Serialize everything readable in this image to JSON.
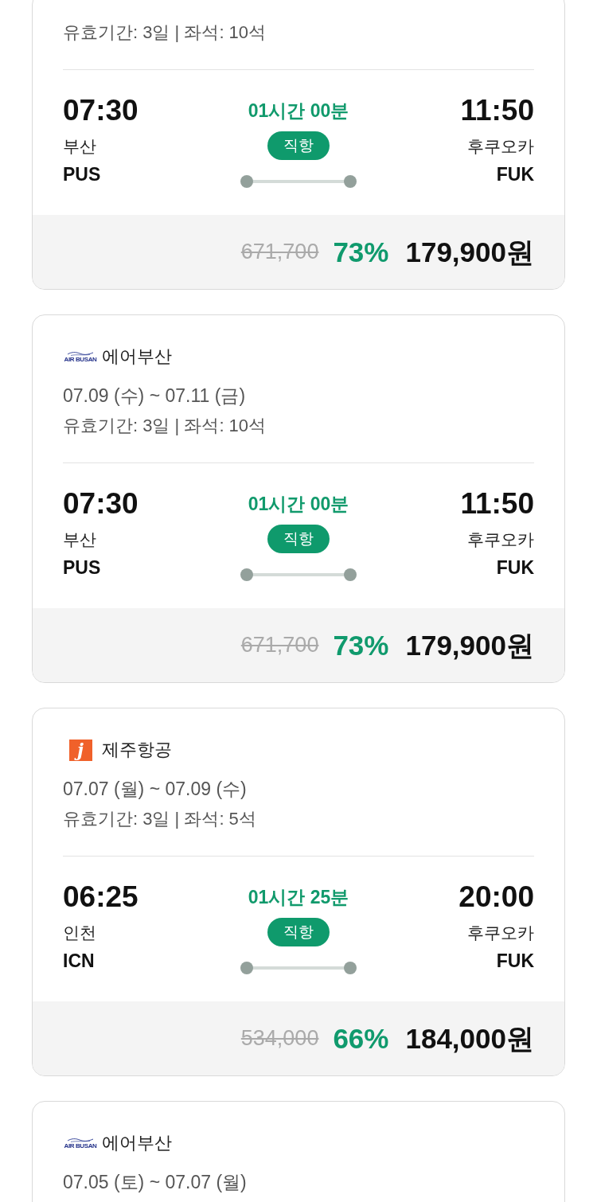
{
  "flights": [
    {
      "validity": "유효기간: 3일 | 좌석: 10석",
      "departure": {
        "time": "07:30",
        "city": "부산",
        "code": "PUS"
      },
      "duration": "01시간 00분",
      "route_type": "직항",
      "arrival": {
        "time": "11:50",
        "city": "후쿠오카",
        "code": "FUK"
      },
      "price": {
        "original": "671,700",
        "discount": "73%",
        "final": "179,900원"
      }
    },
    {
      "airline": {
        "name": "에어부산",
        "logo": {
          "kind": "wave_wordmark",
          "text": "AIR BUSAN"
        }
      },
      "dates": "07.09 (수) ~ 07.11 (금)",
      "validity": "유효기간: 3일 | 좌석: 10석",
      "departure": {
        "time": "07:30",
        "city": "부산",
        "code": "PUS"
      },
      "duration": "01시간 00분",
      "route_type": "직항",
      "arrival": {
        "time": "11:50",
        "city": "후쿠오카",
        "code": "FUK"
      },
      "price": {
        "original": "671,700",
        "discount": "73%",
        "final": "179,900원"
      }
    },
    {
      "airline": {
        "name": "제주항공",
        "logo": {
          "kind": "letter_tile",
          "text": "j"
        }
      },
      "dates": "07.07 (월) ~ 07.09 (수)",
      "validity": "유효기간: 3일 | 좌석: 5석",
      "departure": {
        "time": "06:25",
        "city": "인천",
        "code": "ICN"
      },
      "duration": "01시간 25분",
      "route_type": "직항",
      "arrival": {
        "time": "20:00",
        "city": "후쿠오카",
        "code": "FUK"
      },
      "price": {
        "original": "534,000",
        "discount": "66%",
        "final": "184,000원"
      }
    },
    {
      "airline": {
        "name": "에어부산",
        "logo": {
          "kind": "wave_wordmark",
          "text": "AIR BUSAN"
        }
      },
      "dates": "07.05 (토) ~ 07.07 (월)"
    }
  ]
}
